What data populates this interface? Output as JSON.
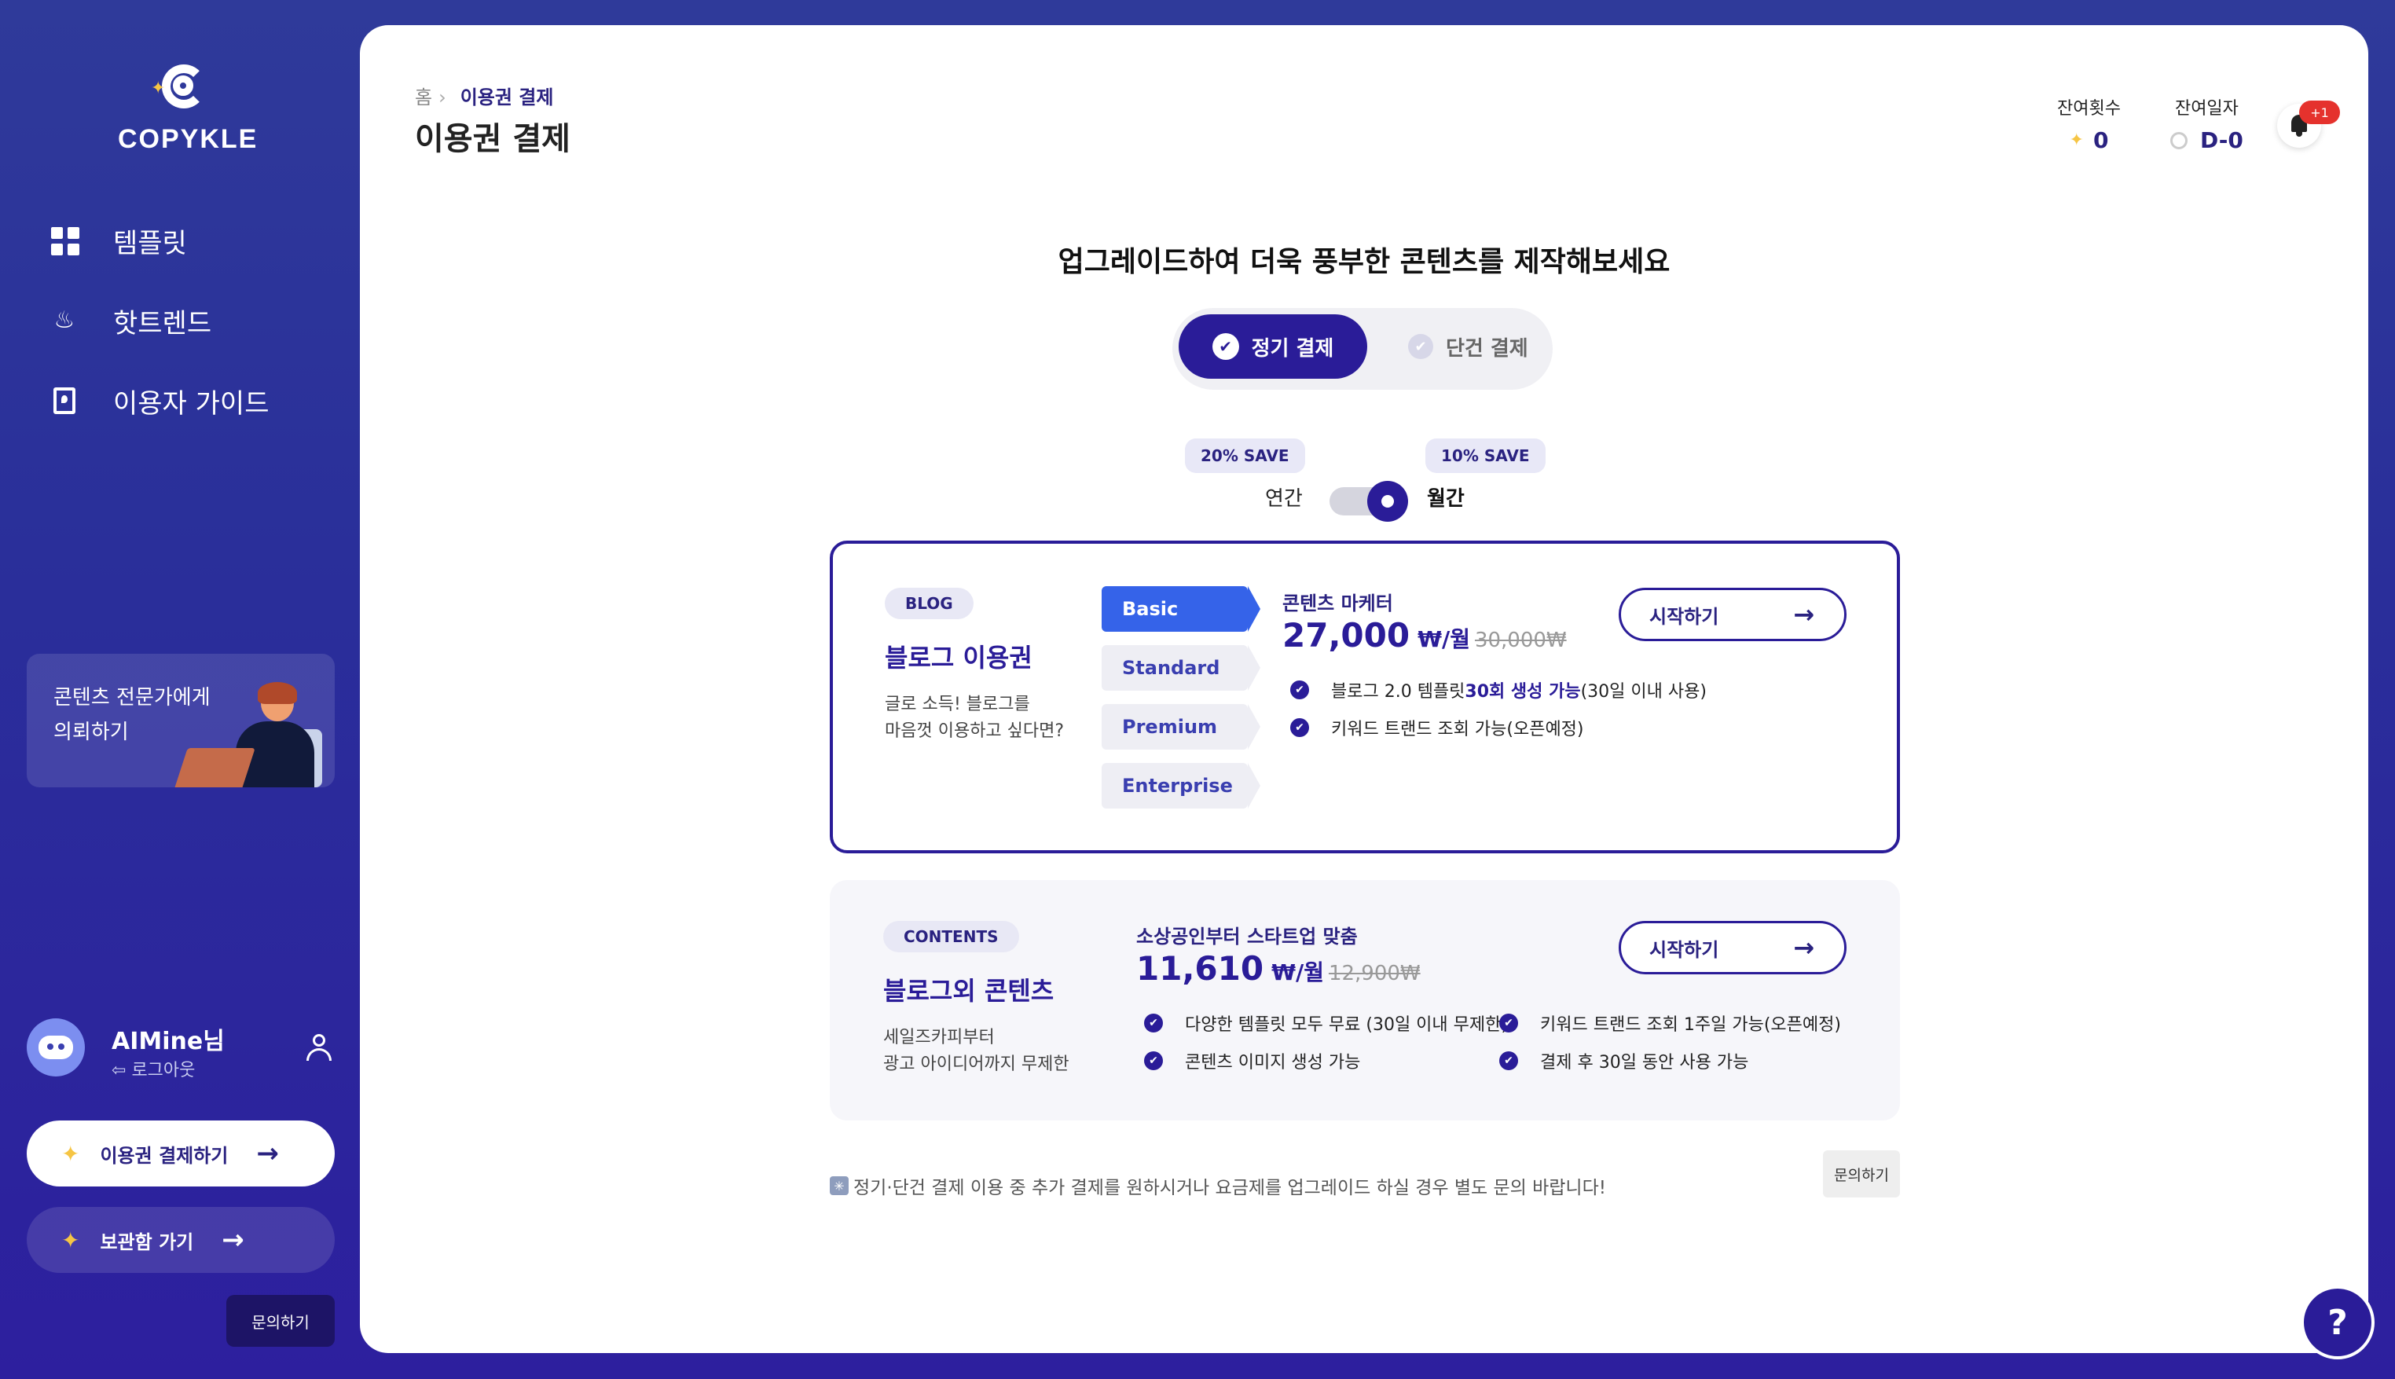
{
  "app": {
    "logo_text": "COPYKLE"
  },
  "sidebar": {
    "items": [
      {
        "label": "템플릿",
        "icon": "grid-icon"
      },
      {
        "label": "핫트렌드",
        "icon": "flame-icon"
      },
      {
        "label": "이용자 가이드",
        "icon": "guide-book-icon"
      }
    ],
    "expert_card": {
      "text": "콘텐츠 전문가에게 의뢰하기"
    },
    "user": {
      "name": "AIMine님",
      "logout_label": "로그아웃"
    },
    "pay_button": "이용권 결제하기",
    "storage_button": "보관함 가기",
    "inquiry_button": "문의하기"
  },
  "header": {
    "breadcrumb_home": "홈",
    "breadcrumb_current": "이용권 결제",
    "title": "이용권 결제",
    "remaining_count_label": "잔여횟수",
    "remaining_count_value": "0",
    "remaining_days_label": "잔여일자",
    "remaining_days_value": "D-0",
    "notification_badge": "+1"
  },
  "main": {
    "headline": "업그레이드하여 더욱 풍부한 콘텐츠를 제작해보세요",
    "payment_types": [
      {
        "label": "정기 결제",
        "selected": true
      },
      {
        "label": "단건 결제",
        "selected": false
      }
    ],
    "billing": {
      "annual_save": "20% SAVE",
      "monthly_save": "10% SAVE",
      "annual_label": "연간",
      "monthly_label": "월간",
      "selected": "월간"
    },
    "plans": [
      {
        "tag": "BLOG",
        "title": "블로그 이용권",
        "desc_line1": "글로 소득! 블로그를",
        "desc_line2": "마음껏 이용하고 싶다면?",
        "tiers": [
          "Basic",
          "Standard",
          "Premium",
          "Enterprise"
        ],
        "selected_tier": "Basic",
        "subtitle": "콘텐츠 마케터",
        "price": "27,000",
        "unit": "₩/월",
        "original_price": "30,000₩",
        "features": [
          {
            "pre": "블로그 2.0 템플릿 ",
            "highlight": "30회 생성 가능",
            "post": " (30일 이내 사용)"
          },
          {
            "pre": "키워드 트랜드 조회 가능(오픈예정)",
            "highlight": "",
            "post": ""
          }
        ],
        "start_label": "시작하기"
      },
      {
        "tag": "CONTENTS",
        "title": "블로그외 콘텐츠",
        "desc_line1": "세일즈카피부터",
        "desc_line2": "광고 아이디어까지 무제한",
        "subtitle": "소상공인부터 스타트업 맞춤",
        "price": "11,610",
        "unit": "₩/월",
        "original_price": "12,900₩",
        "features": [
          "다양한 템플릿 모두 무료 (30일 이내 무제한)",
          "콘텐츠 이미지 생성 가능",
          "키워드 트랜드 조회 1주일 가능(오픈예정)",
          "결제 후 30일 동안 사용 가능"
        ],
        "start_label": "시작하기"
      }
    ],
    "note": "정기·단건 결제 이용 중 추가 결제를 원하시거나 요금제를 업그레이드 하실 경우 별도 문의 바랍니다!",
    "inquiry_label": "문의하기",
    "help_label": "?"
  },
  "colors": {
    "accent": "#2a1c98",
    "tier_active": "#3563e9",
    "badge": "#e5322d"
  }
}
